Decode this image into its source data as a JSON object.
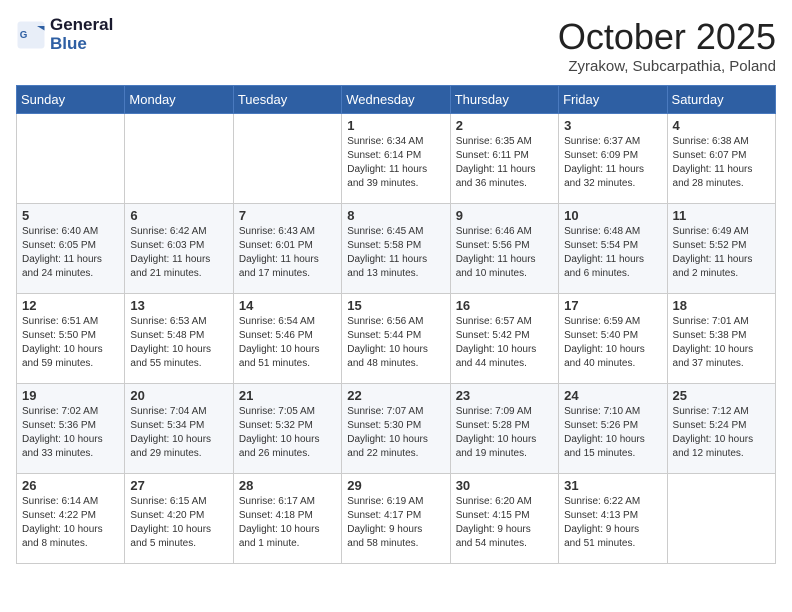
{
  "header": {
    "logo_line1": "General",
    "logo_line2": "Blue",
    "month": "October 2025",
    "location": "Zyrakow, Subcarpathia, Poland"
  },
  "days_of_week": [
    "Sunday",
    "Monday",
    "Tuesday",
    "Wednesday",
    "Thursday",
    "Friday",
    "Saturday"
  ],
  "weeks": [
    [
      {
        "day": "",
        "content": ""
      },
      {
        "day": "",
        "content": ""
      },
      {
        "day": "",
        "content": ""
      },
      {
        "day": "1",
        "content": "Sunrise: 6:34 AM\nSunset: 6:14 PM\nDaylight: 11 hours\nand 39 minutes."
      },
      {
        "day": "2",
        "content": "Sunrise: 6:35 AM\nSunset: 6:11 PM\nDaylight: 11 hours\nand 36 minutes."
      },
      {
        "day": "3",
        "content": "Sunrise: 6:37 AM\nSunset: 6:09 PM\nDaylight: 11 hours\nand 32 minutes."
      },
      {
        "day": "4",
        "content": "Sunrise: 6:38 AM\nSunset: 6:07 PM\nDaylight: 11 hours\nand 28 minutes."
      }
    ],
    [
      {
        "day": "5",
        "content": "Sunrise: 6:40 AM\nSunset: 6:05 PM\nDaylight: 11 hours\nand 24 minutes."
      },
      {
        "day": "6",
        "content": "Sunrise: 6:42 AM\nSunset: 6:03 PM\nDaylight: 11 hours\nand 21 minutes."
      },
      {
        "day": "7",
        "content": "Sunrise: 6:43 AM\nSunset: 6:01 PM\nDaylight: 11 hours\nand 17 minutes."
      },
      {
        "day": "8",
        "content": "Sunrise: 6:45 AM\nSunset: 5:58 PM\nDaylight: 11 hours\nand 13 minutes."
      },
      {
        "day": "9",
        "content": "Sunrise: 6:46 AM\nSunset: 5:56 PM\nDaylight: 11 hours\nand 10 minutes."
      },
      {
        "day": "10",
        "content": "Sunrise: 6:48 AM\nSunset: 5:54 PM\nDaylight: 11 hours\nand 6 minutes."
      },
      {
        "day": "11",
        "content": "Sunrise: 6:49 AM\nSunset: 5:52 PM\nDaylight: 11 hours\nand 2 minutes."
      }
    ],
    [
      {
        "day": "12",
        "content": "Sunrise: 6:51 AM\nSunset: 5:50 PM\nDaylight: 10 hours\nand 59 minutes."
      },
      {
        "day": "13",
        "content": "Sunrise: 6:53 AM\nSunset: 5:48 PM\nDaylight: 10 hours\nand 55 minutes."
      },
      {
        "day": "14",
        "content": "Sunrise: 6:54 AM\nSunset: 5:46 PM\nDaylight: 10 hours\nand 51 minutes."
      },
      {
        "day": "15",
        "content": "Sunrise: 6:56 AM\nSunset: 5:44 PM\nDaylight: 10 hours\nand 48 minutes."
      },
      {
        "day": "16",
        "content": "Sunrise: 6:57 AM\nSunset: 5:42 PM\nDaylight: 10 hours\nand 44 minutes."
      },
      {
        "day": "17",
        "content": "Sunrise: 6:59 AM\nSunset: 5:40 PM\nDaylight: 10 hours\nand 40 minutes."
      },
      {
        "day": "18",
        "content": "Sunrise: 7:01 AM\nSunset: 5:38 PM\nDaylight: 10 hours\nand 37 minutes."
      }
    ],
    [
      {
        "day": "19",
        "content": "Sunrise: 7:02 AM\nSunset: 5:36 PM\nDaylight: 10 hours\nand 33 minutes."
      },
      {
        "day": "20",
        "content": "Sunrise: 7:04 AM\nSunset: 5:34 PM\nDaylight: 10 hours\nand 29 minutes."
      },
      {
        "day": "21",
        "content": "Sunrise: 7:05 AM\nSunset: 5:32 PM\nDaylight: 10 hours\nand 26 minutes."
      },
      {
        "day": "22",
        "content": "Sunrise: 7:07 AM\nSunset: 5:30 PM\nDaylight: 10 hours\nand 22 minutes."
      },
      {
        "day": "23",
        "content": "Sunrise: 7:09 AM\nSunset: 5:28 PM\nDaylight: 10 hours\nand 19 minutes."
      },
      {
        "day": "24",
        "content": "Sunrise: 7:10 AM\nSunset: 5:26 PM\nDaylight: 10 hours\nand 15 minutes."
      },
      {
        "day": "25",
        "content": "Sunrise: 7:12 AM\nSunset: 5:24 PM\nDaylight: 10 hours\nand 12 minutes."
      }
    ],
    [
      {
        "day": "26",
        "content": "Sunrise: 6:14 AM\nSunset: 4:22 PM\nDaylight: 10 hours\nand 8 minutes."
      },
      {
        "day": "27",
        "content": "Sunrise: 6:15 AM\nSunset: 4:20 PM\nDaylight: 10 hours\nand 5 minutes."
      },
      {
        "day": "28",
        "content": "Sunrise: 6:17 AM\nSunset: 4:18 PM\nDaylight: 10 hours\nand 1 minute."
      },
      {
        "day": "29",
        "content": "Sunrise: 6:19 AM\nSunset: 4:17 PM\nDaylight: 9 hours\nand 58 minutes."
      },
      {
        "day": "30",
        "content": "Sunrise: 6:20 AM\nSunset: 4:15 PM\nDaylight: 9 hours\nand 54 minutes."
      },
      {
        "day": "31",
        "content": "Sunrise: 6:22 AM\nSunset: 4:13 PM\nDaylight: 9 hours\nand 51 minutes."
      },
      {
        "day": "",
        "content": ""
      }
    ]
  ]
}
